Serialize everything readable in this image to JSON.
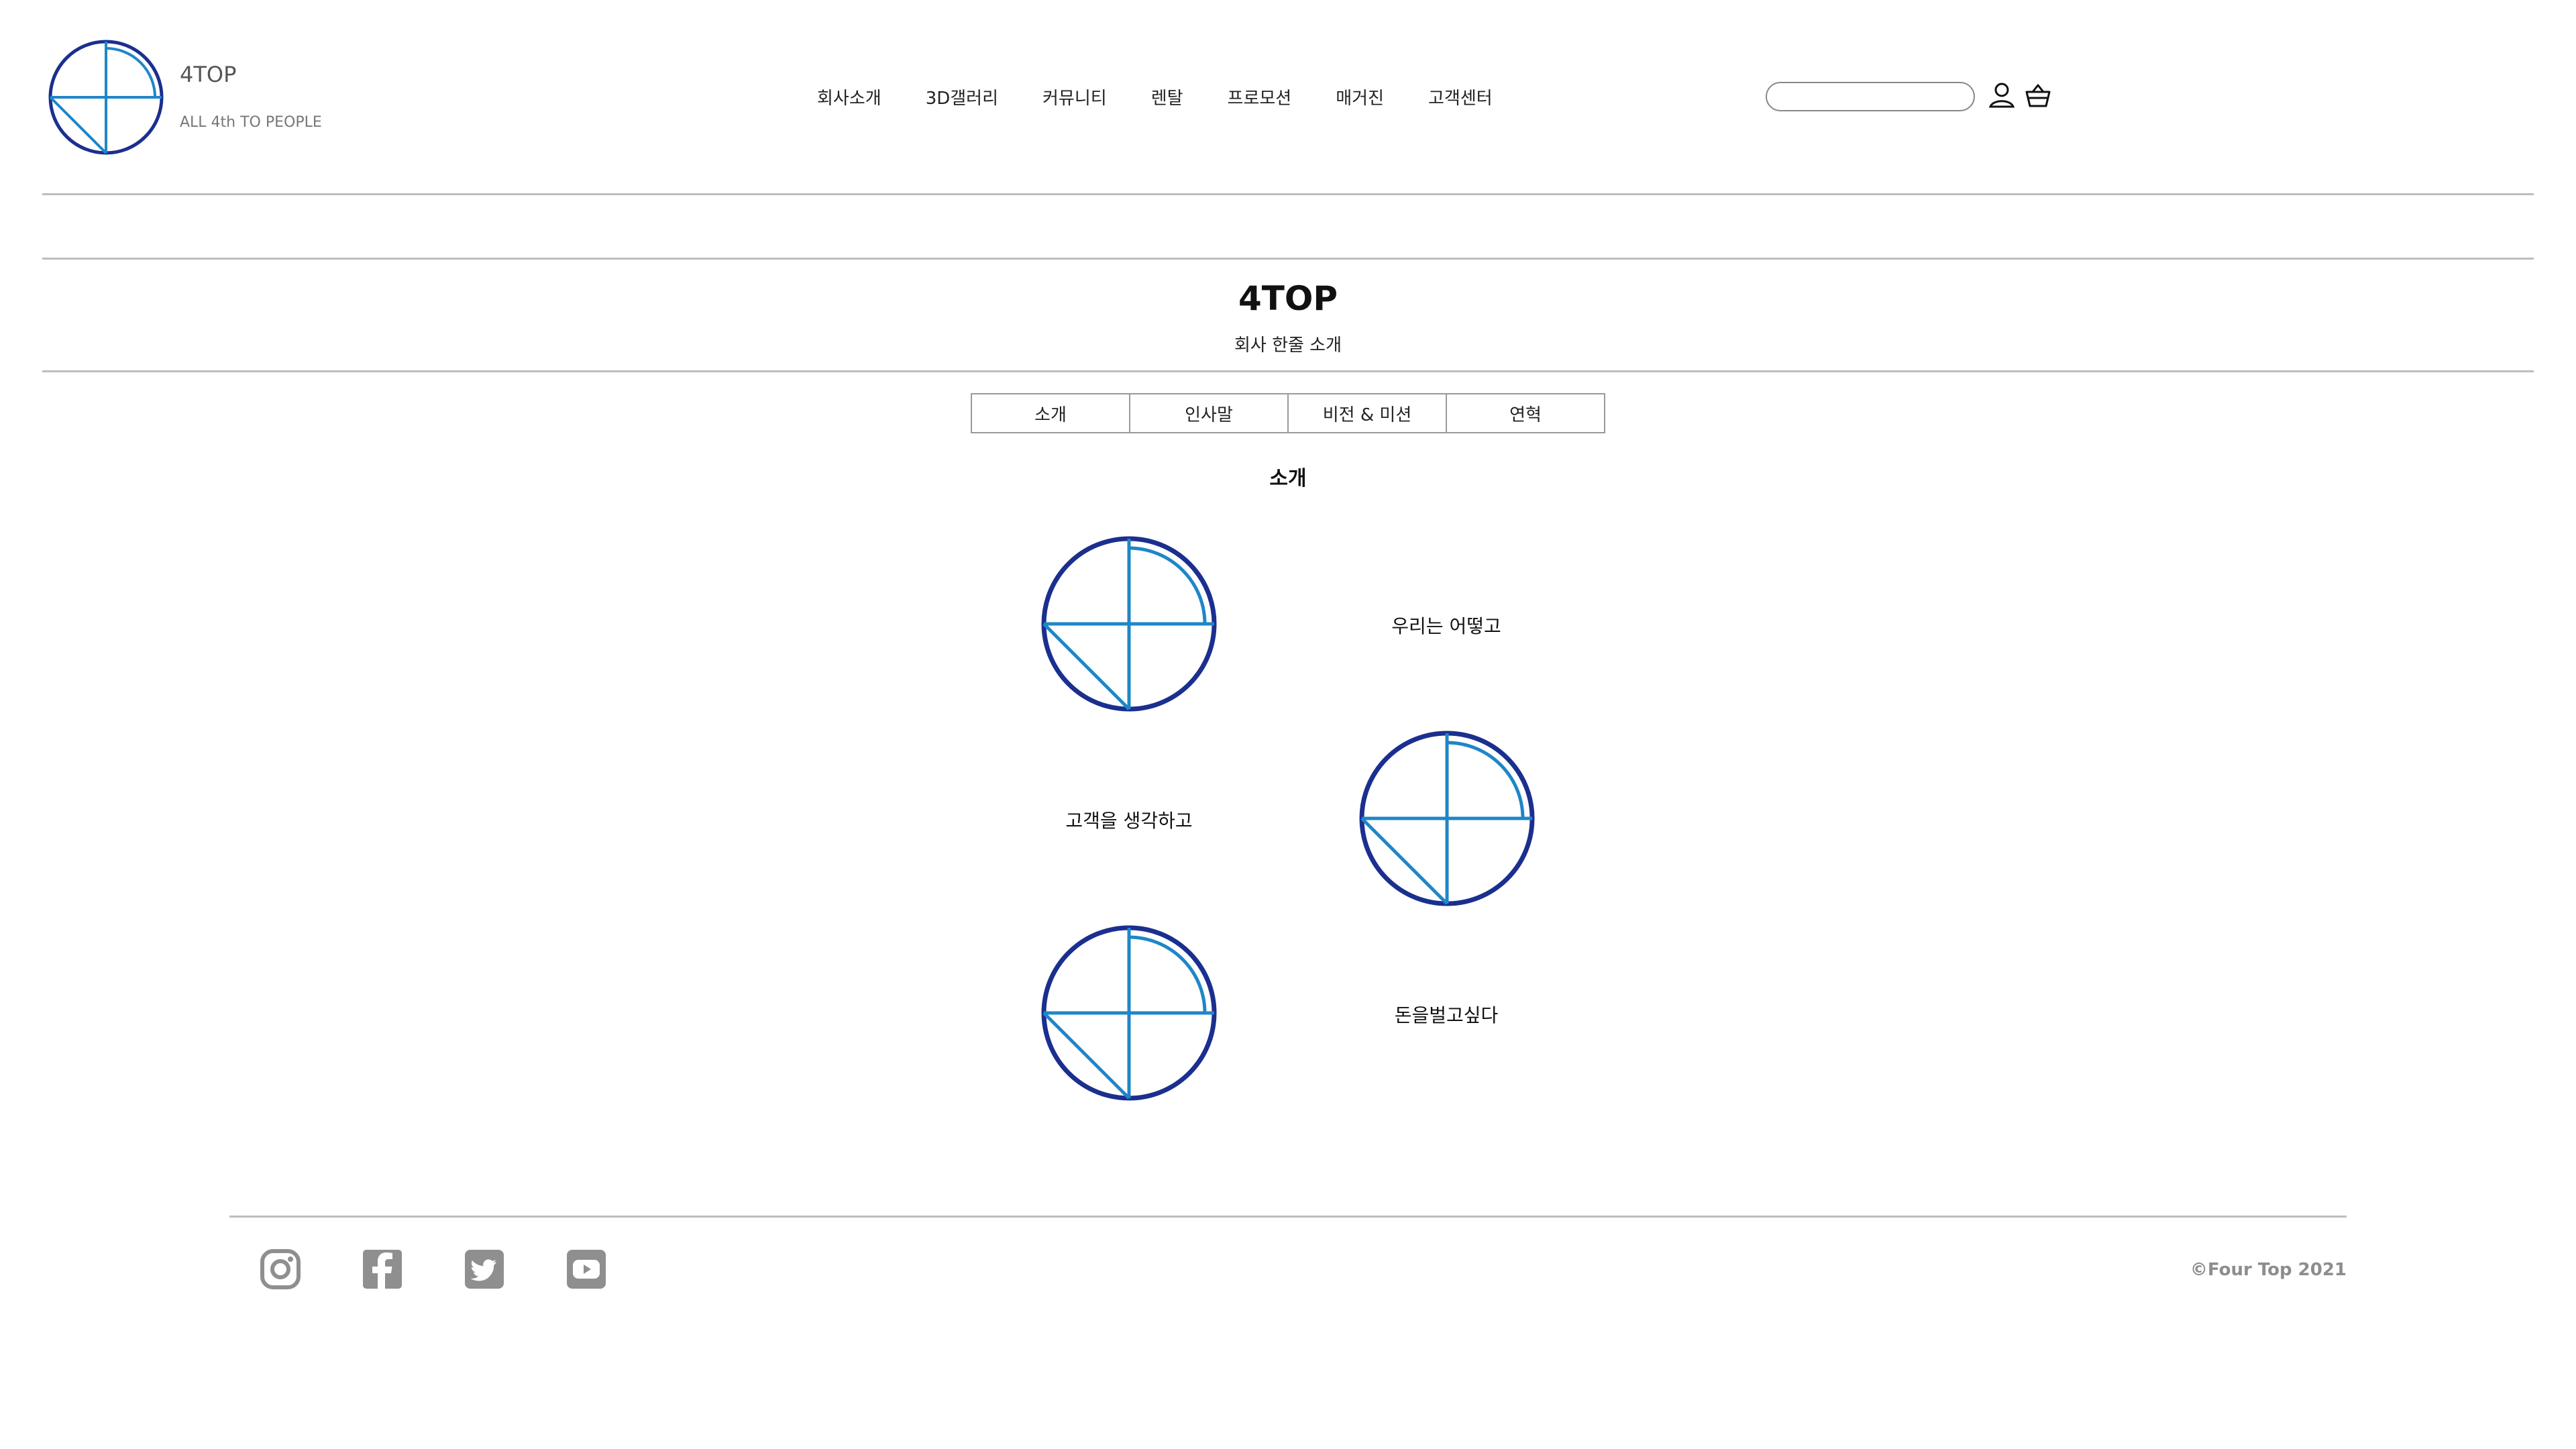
{
  "header": {
    "brand_name": "4TOP",
    "brand_tagline": "ALL 4th TO PEOPLE",
    "logo_icon": "circle-quadrant-logo-icon",
    "nav": [
      {
        "label": "회사소개"
      },
      {
        "label": "3D갤러리"
      },
      {
        "label": "커뮤니티"
      },
      {
        "label": "렌탈"
      },
      {
        "label": "프로모션"
      },
      {
        "label": "매거진"
      },
      {
        "label": "고객센터"
      }
    ],
    "search": {
      "placeholder": "",
      "value": ""
    },
    "icons": {
      "user": "user-icon",
      "cart": "basket-icon"
    }
  },
  "hero": {
    "title": "4TOP",
    "subtitle": "회사 한줄 소개"
  },
  "tabs": [
    {
      "label": "소개"
    },
    {
      "label": "인사말"
    },
    {
      "label": "비전 & 미션"
    },
    {
      "label": "연혁"
    }
  ],
  "section": {
    "heading": "소개",
    "rows": [
      {
        "text": "우리는 어떻고",
        "icon": "circle-quadrant-logo-icon"
      },
      {
        "text": "고객을 생각하고",
        "icon": "circle-quadrant-logo-icon"
      },
      {
        "text": "돈을벌고싶다",
        "icon": "circle-quadrant-logo-icon"
      }
    ]
  },
  "footer": {
    "social": [
      {
        "name": "instagram-icon"
      },
      {
        "name": "facebook-icon"
      },
      {
        "name": "twitter-icon"
      },
      {
        "name": "youtube-icon"
      }
    ],
    "copyright": "©Four Top 2021"
  },
  "colors": {
    "logo_outer": "#1b2f8f",
    "logo_inner": "#1f86c8",
    "divider": "#bdbdbd",
    "footer_icon": "#8f8f8f",
    "muted_text": "#777777"
  }
}
